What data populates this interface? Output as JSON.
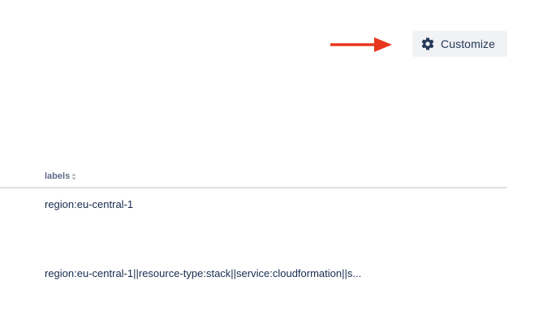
{
  "toolbar": {
    "customize_label": "Customize",
    "customize_icon": "gear-icon"
  },
  "annotation": {
    "arrow_color": "#e8361d"
  },
  "table": {
    "columns": [
      {
        "label": "labels",
        "sortable": true
      }
    ],
    "rows": [
      {
        "labels": "region:eu-central-1"
      },
      {
        "labels": "region:eu-central-1||resource-type:stack||service:cloudformation||s..."
      }
    ]
  }
}
